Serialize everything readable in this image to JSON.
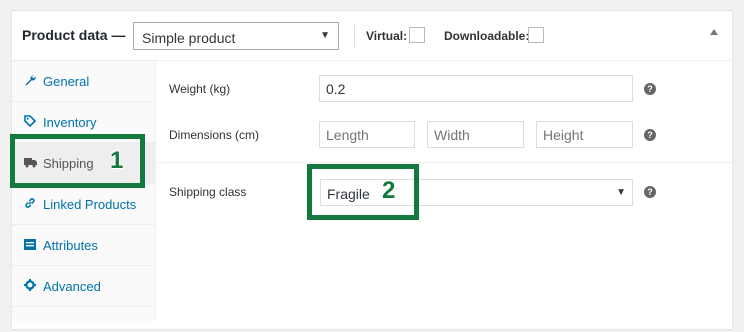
{
  "header": {
    "title": "Product data —",
    "product_type": "Simple product",
    "virtual_label": "Virtual:",
    "downloadable_label": "Downloadable:"
  },
  "sidebar": {
    "items": [
      {
        "label": "General",
        "icon": "wrench-icon"
      },
      {
        "label": "Inventory",
        "icon": "tag-icon"
      },
      {
        "label": "Shipping",
        "icon": "truck-icon"
      },
      {
        "label": "Linked Products",
        "icon": "link-icon"
      },
      {
        "label": "Attributes",
        "icon": "list-icon"
      },
      {
        "label": "Advanced",
        "icon": "gear-icon"
      }
    ],
    "active": "Shipping"
  },
  "shipping": {
    "weight_label": "Weight (kg)",
    "weight_value": "0.2",
    "dimensions_label": "Dimensions (cm)",
    "length_placeholder": "Length",
    "width_placeholder": "Width",
    "height_placeholder": "Height",
    "class_label": "Shipping class",
    "class_value": "Fragile"
  },
  "annotations": {
    "step1": "1",
    "step2": "2"
  },
  "colors": {
    "accent": "#0073aa",
    "highlight": "#127a3e"
  }
}
